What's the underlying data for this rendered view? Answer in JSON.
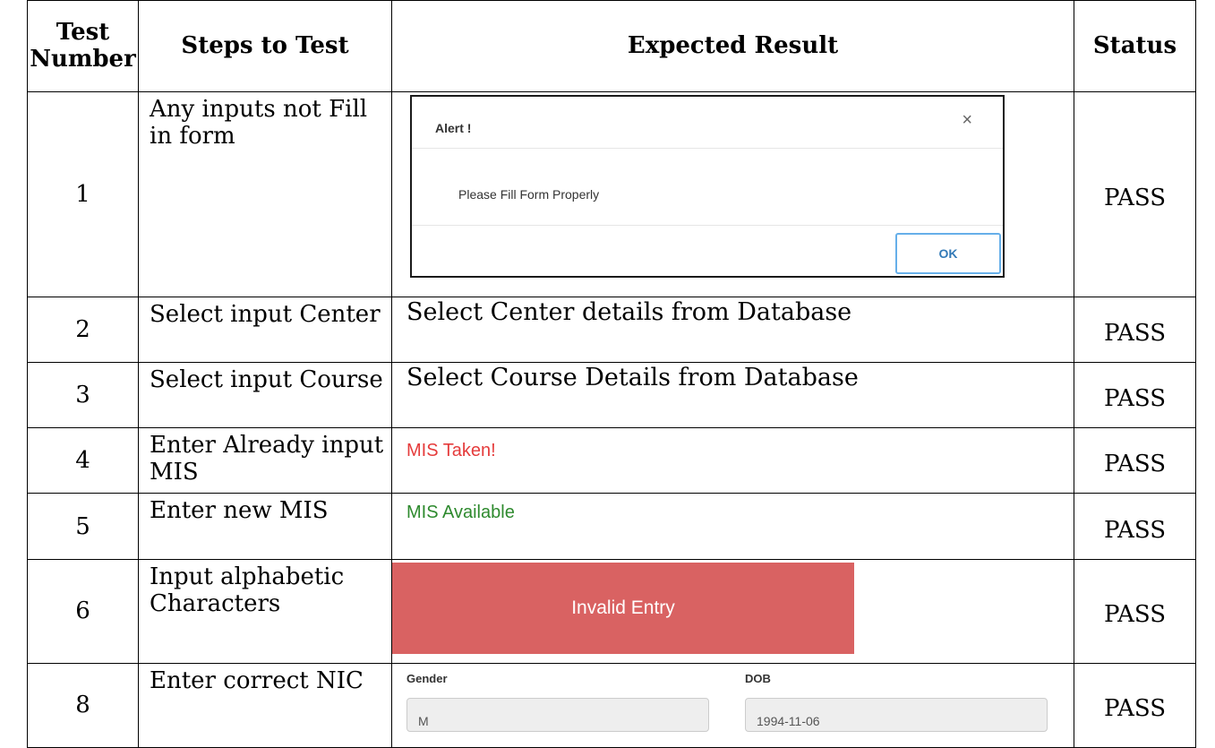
{
  "headers": {
    "test_number": "Test Number",
    "steps": "Steps to Test",
    "expected": "Expected Result",
    "status": "Status"
  },
  "rows": [
    {
      "number": "1",
      "steps": "Any inputs not Fill in form",
      "status": "PASS",
      "alert": {
        "title": "Alert !",
        "close": "×",
        "message": "Please Fill Form Properly",
        "ok_label": "OK"
      }
    },
    {
      "number": "2",
      "steps": "Select input Center",
      "expected": "Select Center details from Database",
      "status": "PASS"
    },
    {
      "number": "3",
      "steps": "Select input Course",
      "expected": "Select Course Details from Database",
      "status": "PASS"
    },
    {
      "number": "4",
      "steps": "Enter Already input MIS",
      "expected": "MIS Taken!",
      "status": "PASS"
    },
    {
      "number": "5",
      "steps": "Enter new MIS",
      "expected": "MIS Available",
      "status": "PASS"
    },
    {
      "number": "6",
      "steps": "Input alphabetic Characters",
      "expected": "Invalid Entry",
      "status": "PASS"
    },
    {
      "number": "8",
      "steps": "Enter correct NIC",
      "status": "PASS",
      "form": {
        "gender_label": "Gender",
        "gender_value": "M",
        "dob_label": "DOB",
        "dob_value": "1994-11-06"
      }
    }
  ],
  "colors": {
    "mis_taken": "#e53c3c",
    "mis_available": "#2e8a2e",
    "invalid_bg": "#d96262"
  }
}
